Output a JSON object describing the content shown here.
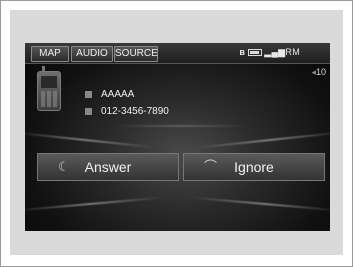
{
  "top_tabs": [
    {
      "label": "MAP"
    },
    {
      "label": "AUDIO"
    },
    {
      "label": "SOURCE"
    }
  ],
  "status": {
    "bluetooth_icon": "bluetooth-icon",
    "battery_icon": "battery-icon",
    "signal_icon": "signal-icon",
    "roaming": "RM"
  },
  "volume": {
    "icon": "speaker-icon",
    "level": "10"
  },
  "caller": {
    "name": "AAAAA",
    "number": "012-3456-7890"
  },
  "actions": {
    "answer": {
      "label": "Answer",
      "icon": "answer-phone-icon"
    },
    "ignore": {
      "label": "Ignore",
      "icon": "ignore-phone-icon"
    }
  }
}
